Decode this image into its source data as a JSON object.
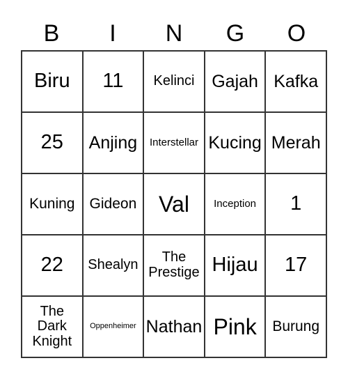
{
  "card": {
    "title": "BINGO",
    "header_letters": [
      "B",
      "I",
      "N",
      "G",
      "O"
    ],
    "border_color": "#333333",
    "background_color": "#ffffff",
    "text_color": "#000000",
    "rows": [
      [
        {
          "text": "Biru",
          "size": "fs-xl"
        },
        {
          "text": "11",
          "size": "fs-xl"
        },
        {
          "text": "Kelinci",
          "size": "fs-s"
        },
        {
          "text": "Gajah",
          "size": "fs-l"
        },
        {
          "text": "Kafka",
          "size": "fs-l"
        }
      ],
      [
        {
          "text": "25",
          "size": "fs-xl"
        },
        {
          "text": "Anjing",
          "size": "fs-l"
        },
        {
          "text": "Interstellar",
          "size": "fs-xs"
        },
        {
          "text": "Kucing",
          "size": "fs-l"
        },
        {
          "text": "Merah",
          "size": "fs-l"
        }
      ],
      [
        {
          "text": "Kuning",
          "size": "fs-m"
        },
        {
          "text": "Gideon",
          "size": "fs-m"
        },
        {
          "text": "Val",
          "size": "fs-xxl"
        },
        {
          "text": "Inception",
          "size": "fs-xs"
        },
        {
          "text": "1",
          "size": "fs-xl"
        }
      ],
      [
        {
          "text": "22",
          "size": "fs-xl"
        },
        {
          "text": "Shealyn",
          "size": "fs-s"
        },
        {
          "text": "The Prestige",
          "size": "fs-s"
        },
        {
          "text": "Hijau",
          "size": "fs-xl"
        },
        {
          "text": "17",
          "size": "fs-xl"
        }
      ],
      [
        {
          "text": "The Dark Knight",
          "size": "fs-s"
        },
        {
          "text": "Oppenheimer",
          "size": "fs-xxs"
        },
        {
          "text": "Nathan",
          "size": "fs-l"
        },
        {
          "text": "Pink",
          "size": "fs-xxl"
        },
        {
          "text": "Burung",
          "size": "fs-m"
        }
      ]
    ]
  }
}
